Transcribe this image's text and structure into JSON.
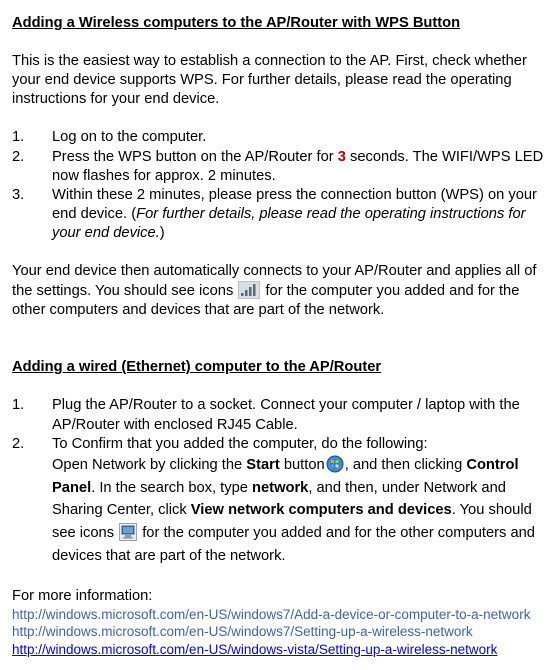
{
  "section1": {
    "heading": "Adding a Wireless computers to the AP/Router with WPS Button",
    "intro": "This is the easiest way to establish a connection to the AP. First, check whether your end device supports WPS. For further details, please read the operating instructions for your end device.",
    "steps": {
      "s1": "Log on to the computer.",
      "s2a": "Press the WPS button on the AP/Router for ",
      "s2_red": "3",
      "s2b": " seconds. The WIFI/WPS LED now flashes for approx. 2 minutes.",
      "s3a": "Within these 2 minutes, please press the connection button (WPS) on your end device. (",
      "s3_italic": "For further details, please read the operating instructions for your end device.",
      "s3b": ")"
    },
    "post_a": "Your end device then automatically connects to your AP/Router and applies all of the settings. You should see icons ",
    "post_b": " for the computer you added and for the other computers and devices that are part of the network."
  },
  "section2": {
    "heading": "Adding a wired (Ethernet) computer to the AP/Router",
    "steps": {
      "s1": "Plug the AP/Router to a socket. Connect your computer / laptop with the AP/Router with enclosed RJ45 Cable.",
      "s2": "To Confirm that you added the computer, do the following:",
      "s2_detail_a": "Open Network by clicking the ",
      "s2_start": "Start",
      "s2_detail_b": " button",
      "s2_detail_c": ", and then clicking ",
      "s2_cp": "Control Panel",
      "s2_detail_d": ". In the search box, type ",
      "s2_network": "network",
      "s2_detail_e": ", and then, under Network and Sharing Center, click ",
      "s2_view": "View network computers and devices",
      "s2_detail_f": ".  You should see icons ",
      "s2_detail_g": " for the computer you added and for the other computers and devices that are part of the network."
    }
  },
  "footer": {
    "label": "For more information:",
    "link1": "http://windows.microsoft.com/en-US/windows7/Add-a-device-or-computer-to-a-network",
    "link2": "http://windows.microsoft.com/en-US/windows7/Setting-up-a-wireless-network",
    "link3": "http://windows.microsoft.com/en-US/windows-vista/Setting-up-a-wireless-network"
  }
}
